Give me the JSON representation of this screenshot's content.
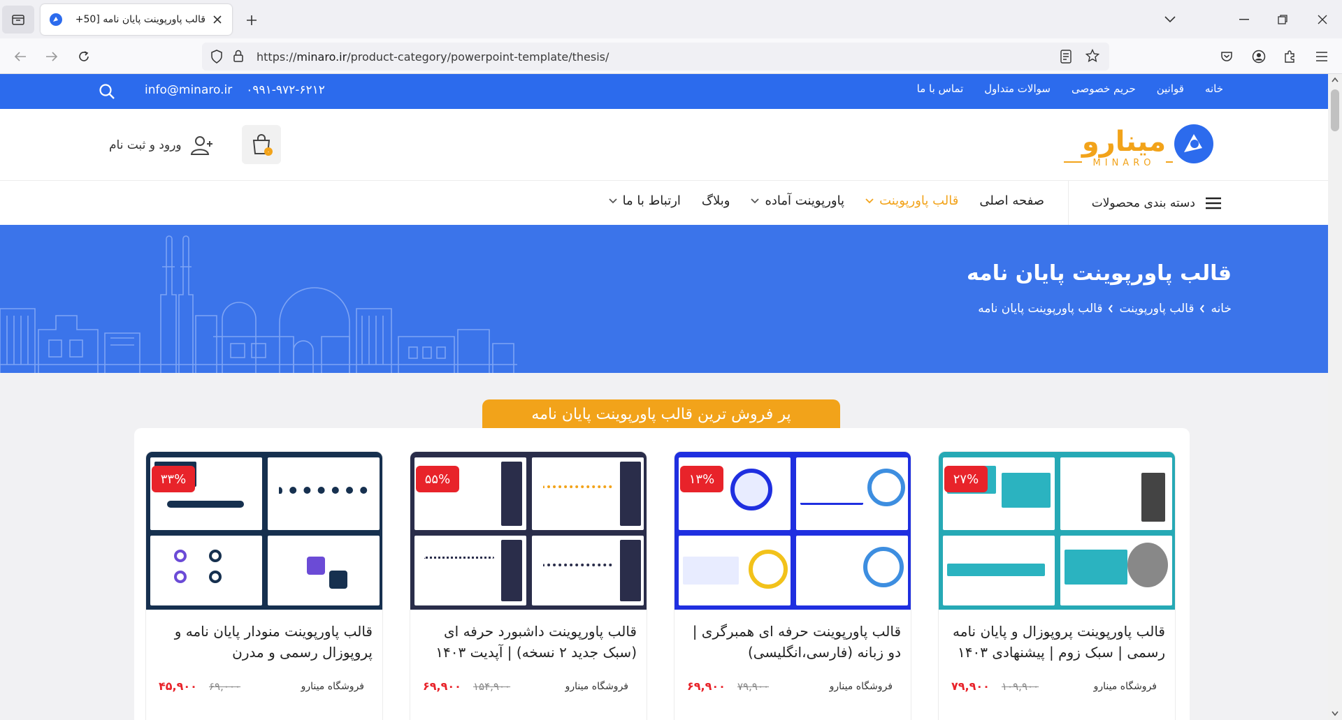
{
  "browser": {
    "tab_title": "قالب پاورپوینت پایان نامه [50+",
    "url_prefix": "https://",
    "url_domain": "minaro.ir",
    "url_path": "/product-category/powerpoint-template/thesis/"
  },
  "topbar": {
    "links": [
      "خانه",
      "قوانین",
      "حریم خصوصی",
      "سوالات متداول",
      "تماس با ما"
    ],
    "phone": "۰۹۹۱-۹۷۲-۶۲۱۲",
    "email": "info@minaro.ir"
  },
  "header": {
    "logo_text": "مینارو",
    "logo_sub": "MINARO",
    "cart_count": "۰",
    "login_label": "ورود و ثبت نام"
  },
  "nav": {
    "categories_label": "دسته بندی محصولات",
    "items": [
      "صفحه اصلی",
      "قالب پاورپوینت",
      "پاورپوینت آماده",
      "وبلاگ",
      "ارتباط با ما"
    ]
  },
  "hero": {
    "title": "قالب پاورپوینت پایان نامه",
    "breadcrumb": [
      "خانه",
      "قالب پاورپوینت",
      "قالب پاورپوینت پایان نامه"
    ]
  },
  "section": {
    "best_sellers_title": "پر فروش ترین قالب پاورپوینت پایان نامه"
  },
  "products": [
    {
      "badge": "۲۷%",
      "title": "قالب پاورپوینت پروپوزال و پایان نامه رسمی | سبک زوم | پیشنهادی ۱۴۰۳",
      "seller": "فروشگاه مینارو",
      "old_price": "۱۰۹,۹۰۰",
      "price": "۷۹,۹۰۰",
      "theme": "#26a9b5"
    },
    {
      "badge": "۱۳%",
      "title": "قالب پاورپوینت حرفه ای همبرگری | دو زبانه (فارسی،انگلیسی)",
      "seller": "فروشگاه مینارو",
      "old_price": "۷۹,۹۰۰",
      "price": "۶۹,۹۰۰",
      "theme": "#1f2fe0"
    },
    {
      "badge": "۵۵%",
      "title": "قالب پاورپوینت داشبورد حرفه ای (سبک جدید ۲ نسخه) | آپدیت ۱۴۰۳",
      "seller": "فروشگاه مینارو",
      "old_price": "۱۵۴,۹۰۰",
      "price": "۶۹,۹۰۰",
      "theme": "#2a2d4a"
    },
    {
      "badge": "۳۳%",
      "title": "قالب پاورپوینت منودار پایان نامه و پروپوزال رسمی و مدرن",
      "seller": "فروشگاه مینارو",
      "old_price": "۶۹,۰۰۰",
      "price": "۴۵,۹۰۰",
      "theme": "#16304f"
    }
  ]
}
